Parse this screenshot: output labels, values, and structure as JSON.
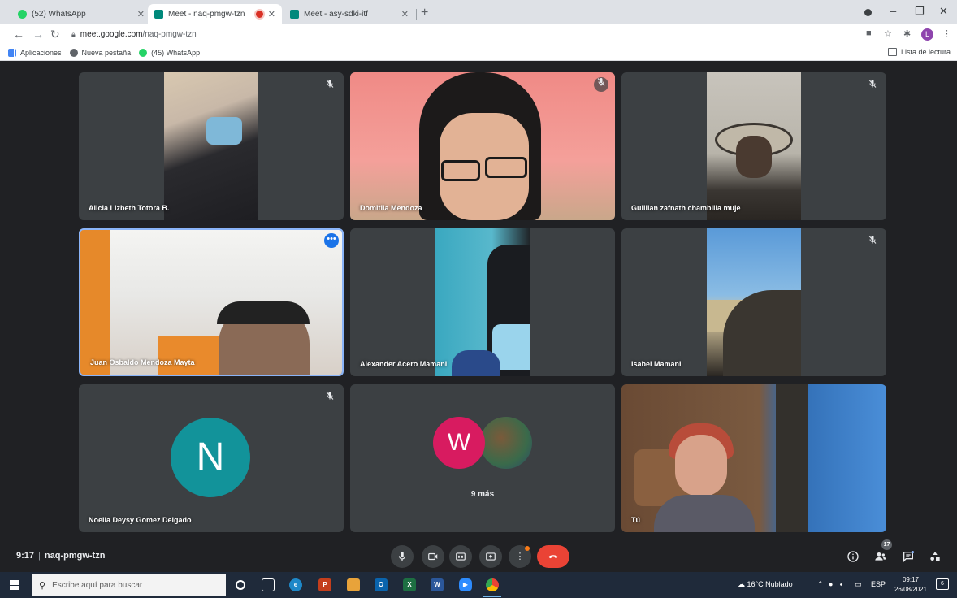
{
  "browser": {
    "tabs": [
      {
        "title": "(52) WhatsApp",
        "color": "#25d366",
        "active": false
      },
      {
        "title": "Meet - naq-pmgw-tzn",
        "color": "#00897b",
        "active": true
      },
      {
        "title": "Meet - asy-sdki-itf",
        "color": "#00897b",
        "active": false
      }
    ],
    "new_tab": "+",
    "window_controls": {
      "minimize": "–",
      "maximize": "❐",
      "close": "✕"
    },
    "url_host": "meet.google.com",
    "url_path": "/naq-pmgw-tzn",
    "profile_initial": "L",
    "bookmarks": [
      {
        "label": "Aplicaciones",
        "color": "#4285f4"
      },
      {
        "label": "Nueva pestaña",
        "color": "#5f6368"
      },
      {
        "label": "(45) WhatsApp",
        "color": "#25d366"
      }
    ],
    "reading_list": "Lista de lectura"
  },
  "meet": {
    "participants": [
      {
        "name": "Alicia Lizbeth Totora B.",
        "muted": true
      },
      {
        "name": "Domitila Mendoza",
        "muted": true
      },
      {
        "name": "Guillian zafnath chambilla muje",
        "muted": true
      },
      {
        "name": "Juan Osbaldo Mendoza Mayta",
        "muted": false,
        "speaking": true
      },
      {
        "name": "Alexander Acero Mamani",
        "muted": false
      },
      {
        "name": "Isabel Mamani",
        "muted": true
      },
      {
        "name": "Noelia Deysy Gomez Delgado",
        "muted": true,
        "initial": "N"
      },
      {
        "name": "",
        "initial": "W",
        "more_label": "9 más"
      },
      {
        "name": "Tú"
      }
    ],
    "time": "9:17",
    "meeting_code": "naq-pmgw-tzn",
    "participant_count": "17",
    "end_color": "#ea4335"
  },
  "taskbar": {
    "search_placeholder": "Escribe aquí para buscar",
    "weather": "16°C  Nublado",
    "language": "ESP",
    "time": "09:17",
    "date": "26/08/2021",
    "notifications": "6"
  }
}
